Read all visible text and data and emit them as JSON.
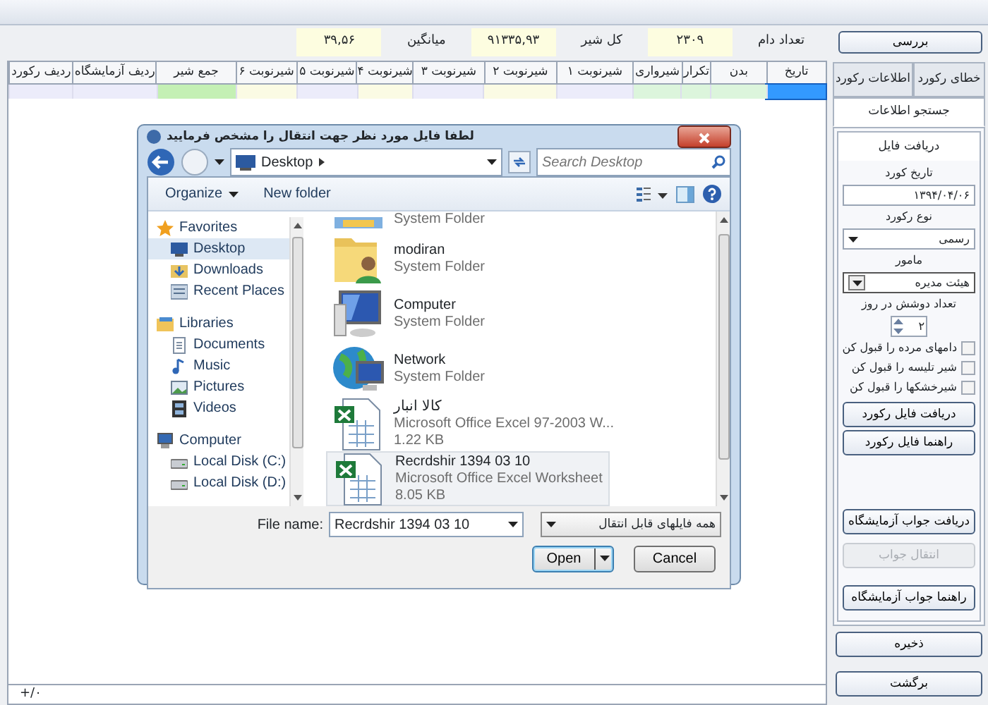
{
  "app": {
    "check_button": "بررسی",
    "stats": [
      {
        "label": "تعداد دام",
        "value": "۲۳۰۹"
      },
      {
        "label": "کل شیر",
        "value": "۹۱۳۳۵,۹۳"
      },
      {
        "label": "میانگین",
        "value": "۳۹,۵۶"
      }
    ],
    "grid": {
      "columns": [
        {
          "label": "تاریخ",
          "color": "#3399ff",
          "selected": true
        },
        {
          "label": "بدن",
          "color": "#dcf5dc",
          "selected": false
        },
        {
          "label": "تکرار",
          "color": "#dcf5dc",
          "selected": false
        },
        {
          "label": "شیرواری",
          "color": "#dcf5dc",
          "selected": false
        },
        {
          "label": "شیرنوبت ۱",
          "color": "#ececfa",
          "selected": false
        },
        {
          "label": "شیرنوبت ۲",
          "color": "#fbfbe4",
          "selected": false
        },
        {
          "label": "شیرنوبت ۳",
          "color": "#ececfa",
          "selected": false
        },
        {
          "label": "شیرنوبت ۴",
          "color": "#fbfbe4",
          "selected": false
        },
        {
          "label": "شیرنوبت ۵",
          "color": "#ececfa",
          "selected": false
        },
        {
          "label": "شیرنوبت ۶",
          "color": "#fbfbe4",
          "selected": false
        },
        {
          "label": "جمع شیر",
          "color": "#c4f0b4",
          "selected": false
        },
        {
          "label": "ردیف آزمایشگاه",
          "color": "#ececfa",
          "selected": false
        },
        {
          "label": "ردیف رکورد",
          "color": "#ececfa",
          "selected": false
        }
      ]
    },
    "status_bar": "+/۰"
  },
  "side_panel": {
    "tabs": [
      {
        "label": "خطای رکورد",
        "selected": false
      },
      {
        "label": "اطلاعات رکورد",
        "selected": false
      },
      {
        "label": "جستجو اطلاعات",
        "selected": true
      }
    ],
    "sub_tabs": [
      {
        "label": "دریافت فایل",
        "selected": true
      }
    ],
    "fields": [
      {
        "kind": "text",
        "label": "تاریخ کورد",
        "value": "۱۳۹۴/۰۴/۰۶"
      },
      {
        "kind": "select",
        "label": "نوع رکورد",
        "value": "رسمی"
      },
      {
        "kind": "combo",
        "label": "مامور",
        "value": "هیئت مدیره"
      },
      {
        "kind": "spinner",
        "label": "تعداد دوشش در روز",
        "value": "۲"
      }
    ],
    "checkboxes": [
      {
        "label": "دامهای مرده را قبول کن",
        "checked": false
      },
      {
        "label": "شیر تلیسه را قبول کن",
        "checked": false
      },
      {
        "label": "شیرخشکها را قبول کن",
        "checked": false
      }
    ],
    "file_buttons": [
      {
        "label": "دریافت فایل رکورد",
        "disabled": false
      },
      {
        "label": "راهنما فایل رکورد",
        "disabled": false
      }
    ],
    "lab_buttons": [
      {
        "label": "دریافت جواب آزمایشگاه",
        "disabled": false
      },
      {
        "label": "انتقال جواب",
        "disabled": true
      },
      {
        "label": "راهنما جواب آزمایشگاه",
        "disabled": false
      }
    ],
    "save_button": "ذخیره",
    "back_button": "برگشت"
  },
  "dialog": {
    "title": "لطفا فایل مورد نظر جهت انتقال را مشخص فرمایید",
    "address": "Desktop",
    "search": {
      "placeholder": "Search Desktop"
    },
    "organize_menu": "Organize",
    "new_folder_button": "New folder",
    "tree": [
      {
        "label": "Favorites",
        "kind": "star",
        "selected": false,
        "children": [
          {
            "label": "Desktop",
            "kind": "desktop",
            "selected": true
          },
          {
            "label": "Downloads",
            "kind": "downloads",
            "selected": false
          },
          {
            "label": "Recent Places",
            "kind": "recent",
            "selected": false
          }
        ]
      },
      {
        "label": "Libraries",
        "kind": "library",
        "selected": false,
        "children": [
          {
            "label": "Documents",
            "kind": "document",
            "selected": false
          },
          {
            "label": "Music",
            "kind": "music",
            "selected": false
          },
          {
            "label": "Pictures",
            "kind": "pictures",
            "selected": false
          },
          {
            "label": "Videos",
            "kind": "videos",
            "selected": false
          }
        ]
      },
      {
        "label": "Computer",
        "kind": "computer",
        "selected": false,
        "children": [
          {
            "label": "Local Disk (C:)",
            "kind": "disk",
            "selected": false
          },
          {
            "label": "Local Disk (D:)",
            "kind": "disk",
            "selected": false
          }
        ]
      }
    ],
    "files": [
      {
        "kind": "folder",
        "type": "System Folder",
        "selected": false
      },
      {
        "kind": "user",
        "name": "modiran",
        "type": "System Folder",
        "selected": false
      },
      {
        "kind": "computer",
        "name": "Computer",
        "type": "System Folder",
        "selected": false
      },
      {
        "kind": "network",
        "name": "Network",
        "type": "System Folder",
        "selected": false
      },
      {
        "kind": "excel",
        "name": "کالا انبار",
        "type": "Microsoft Office Excel 97-2003 W...",
        "size": "1.22 KB",
        "selected": false
      },
      {
        "kind": "excel",
        "name": "Recrdshir 1394 03 10",
        "type": "Microsoft Office Excel Worksheet",
        "size": "8.05 KB",
        "selected": true
      }
    ],
    "file_name_label": "File name:",
    "file_name": "Recrdshir 1394 03 10",
    "filter": "همه فایلهای قابل انتقال",
    "open_button": {
      "label": "Open",
      "default": true
    },
    "cancel_button": {
      "label": "Cancel",
      "default": false
    }
  }
}
